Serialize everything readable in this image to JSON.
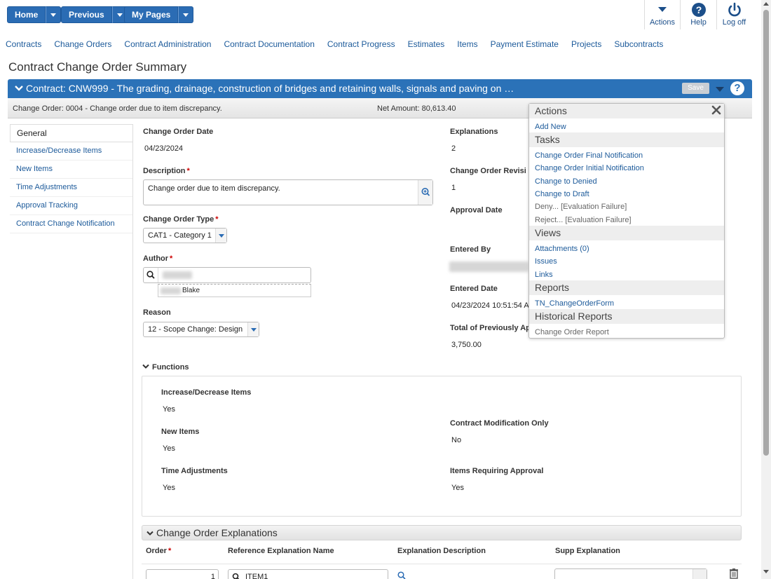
{
  "topbar": {
    "home_label": "Home",
    "previous_label": "Previous",
    "mypages_label": "My Pages",
    "actions_label": "Actions",
    "help_label": "Help",
    "logoff_label": "Log off"
  },
  "nav": {
    "items": [
      "Contracts",
      "Change Orders",
      "Contract Administration",
      "Contract Documentation",
      "Contract Progress",
      "Estimates",
      "Items",
      "Payment Estimate",
      "Projects",
      "Subcontracts"
    ]
  },
  "page_title": "Contract Change Order Summary",
  "contract_bar": {
    "title": "Contract: CNW999 - The grading, drainage, construction of bridges and retaining walls, signals and paving on …",
    "save_label": "Save",
    "help_glyph": "?"
  },
  "info_bar": {
    "change_order": "Change Order: 0004 - Change order due to item discrepancy.",
    "net_amount": "Net Amount: 80,613.40"
  },
  "sidemenu": {
    "items": [
      "General",
      "Increase/Decrease Items",
      "New Items",
      "Time Adjustments",
      "Approval Tracking",
      "Contract Change Notification"
    ]
  },
  "form": {
    "co_date_label": "Change Order Date",
    "co_date_value": "04/23/2024",
    "description_label": "Description",
    "description_value": "Change order due to item discrepancy.",
    "type_label": "Change Order Type",
    "type_value": "CAT1 - Category 1",
    "author_label": "Author",
    "author_suggestion": "Blake",
    "reason_label": "Reason",
    "reason_value": "12 - Scope Change: Design",
    "explanations_label": "Explanations",
    "explanations_value": "2",
    "revision_label": "Change Order Revisi",
    "revision_value": "1",
    "approval_date_label": "Approval Date",
    "entered_by_label": "Entered By",
    "entered_date_label": "Entered Date",
    "entered_date_value": "04/23/2024 10:51:54 A",
    "total_prev_label": "Total of Previously Ap",
    "total_prev_value": "3,750.00",
    "required_mark": "*"
  },
  "actions_panel": {
    "actions_head": "Actions",
    "add_new": "Add New",
    "tasks_head": "Tasks",
    "tasks": [
      "Change Order Final Notification",
      "Change Order Initial Notification",
      "Change to Denied",
      "Change to Draft"
    ],
    "tasks_disabled": [
      "Deny... [Evaluation Failure]",
      "Reject... [Evaluation Failure]"
    ],
    "views_head": "Views",
    "views": [
      "Attachments (0)",
      "Issues",
      "Links"
    ],
    "reports_head": "Reports",
    "reports": [
      "TN_ChangeOrderForm"
    ],
    "historical_head": "Historical Reports",
    "historical": [
      "Change Order Report"
    ]
  },
  "functions": {
    "title": "Functions",
    "incdec_label": "Increase/Decrease Items",
    "incdec_value": "Yes",
    "newitems_label": "New Items",
    "newitems_value": "Yes",
    "time_label": "Time Adjustments",
    "time_value": "Yes",
    "contract_mod_label": "Contract Modification Only",
    "contract_mod_value": "No",
    "items_req_label": "Items Requiring Approval",
    "items_req_value": "Yes"
  },
  "explanations": {
    "title": "Change Order Explanations",
    "col_order": "Order",
    "col_ref": "Reference Explanation Name",
    "col_desc": "Explanation Description",
    "col_supp": "Supp Explanation",
    "row1_order": "1",
    "row1_ref": "ITEM1"
  }
}
